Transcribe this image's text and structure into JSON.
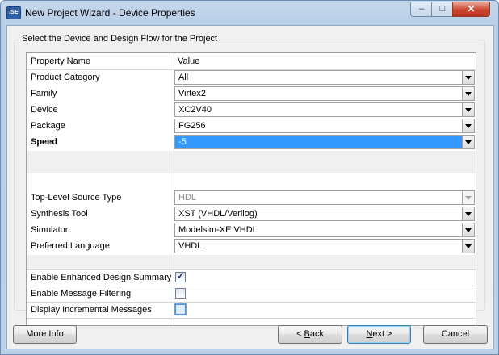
{
  "window": {
    "title": "New Project Wizard - Device Properties",
    "icon_label": "ISE",
    "controls": {
      "minimize": "–",
      "maximize": "□",
      "close": "✕"
    }
  },
  "group": {
    "title": "Select the Device and Design Flow for the Project"
  },
  "grid": {
    "headers": {
      "name": "Property Name",
      "value": "Value"
    },
    "device_rows": [
      {
        "name": "Product Category",
        "value": "All"
      },
      {
        "name": "Family",
        "value": "Virtex2"
      },
      {
        "name": "Device",
        "value": "XC2V40"
      },
      {
        "name": "Package",
        "value": "FG256"
      },
      {
        "name": "Speed",
        "value": "-5"
      }
    ],
    "flow_rows": [
      {
        "name": "Top-Level Source Type",
        "value": "HDL"
      },
      {
        "name": "Synthesis Tool",
        "value": "XST (VHDL/Verilog)"
      },
      {
        "name": "Simulator",
        "value": "Modelsim-XE VHDL"
      },
      {
        "name": "Preferred Language",
        "value": "VHDL"
      }
    ],
    "option_rows": [
      {
        "name": "Enable Enhanced Design Summary",
        "checked": true
      },
      {
        "name": "Enable Message Filtering",
        "checked": false
      },
      {
        "name": "Display Incremental Messages",
        "checked": false
      }
    ]
  },
  "buttons": {
    "more_info": "More Info",
    "back_prefix": "< ",
    "back_key": "B",
    "back_rest": "ack",
    "next_key": "N",
    "next_rest": "ext >",
    "cancel": "Cancel"
  },
  "colors": {
    "selection": "#3399ff",
    "window_frame": "#b9cfe8",
    "client": "#f0f0f0"
  }
}
